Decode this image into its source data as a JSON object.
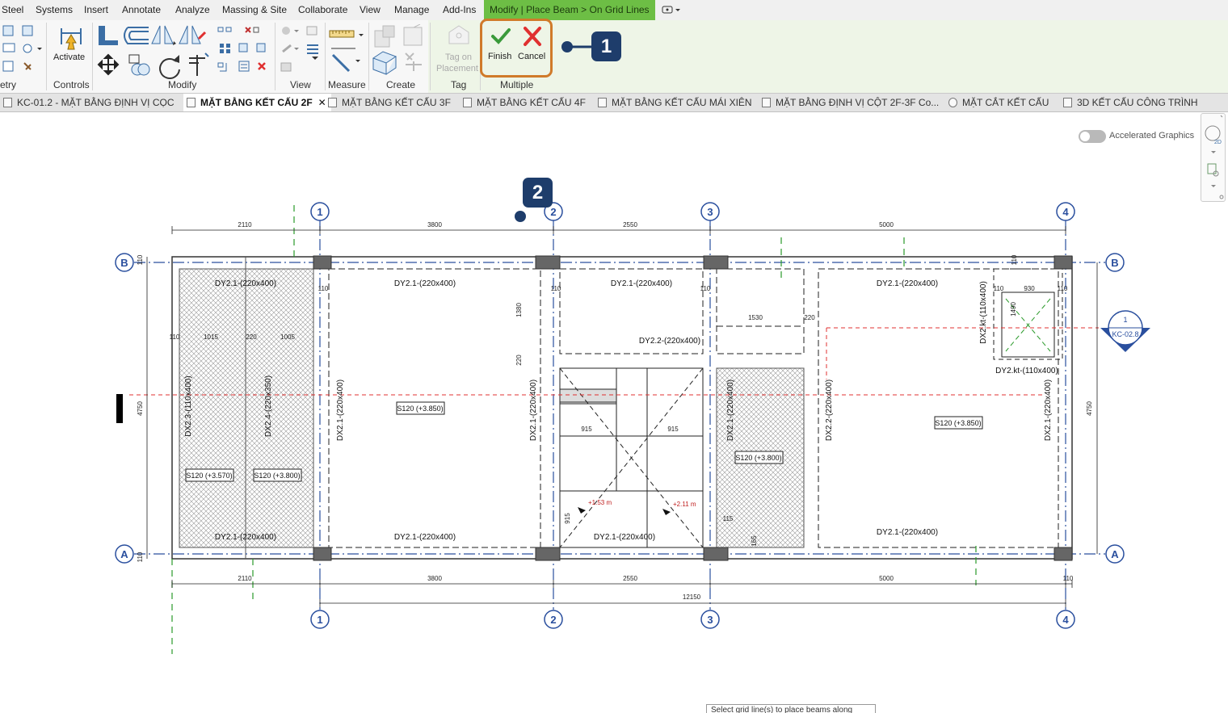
{
  "menu": {
    "items": [
      "Steel",
      "Systems",
      "Insert",
      "Annotate",
      "Analyze",
      "Massing & Site",
      "Collaborate",
      "View",
      "Manage",
      "Add-Ins"
    ],
    "context_tab": "Modify | Place Beam > On Grid Lines"
  },
  "ribbon": {
    "panels": {
      "geometry": "etry",
      "controls": "Controls",
      "modify": "Modify",
      "view": "View",
      "measure": "Measure",
      "create": "Create",
      "tag": "Tag",
      "multiple": "Multiple"
    },
    "activate_label": "Activate",
    "tag_on_label_1": "Tag on",
    "tag_on_label_2": "Placement",
    "finish_label": "Finish",
    "cancel_label": "Cancel"
  },
  "tabs": [
    {
      "label": "KC-01.2 - MẶT BẰNG ĐỊNH VỊ CỌC"
    },
    {
      "label": "MẶT BẰNG KẾT CẤU 2F"
    },
    {
      "label": "MẶT BẰNG KẾT CẤU 3F"
    },
    {
      "label": "MẶT BẰNG KẾT CẤU 4F"
    },
    {
      "label": "MẶT BẰNG KẾT CẤU MÁI XIÊN"
    },
    {
      "label": "MẶT BẰNG ĐỊNH VỊ CỘT 2F-3F Co..."
    },
    {
      "label": "MẶT CẮT KẾT CẤU"
    },
    {
      "label": "3D KẾT CẤU CÔNG TRÌNH"
    }
  ],
  "canvas": {
    "accelerated_graphics": "Accelerated Graphics",
    "status_text": "Select grid line(s) to place beams along"
  },
  "callouts": {
    "one": "1",
    "two": "2"
  },
  "drawing": {
    "grid_cols": [
      "1",
      "2",
      "3",
      "4"
    ],
    "grid_rows": [
      "B",
      "A"
    ],
    "top_dims": [
      "2110",
      "3800",
      "2550",
      "5000"
    ],
    "bottom_dims": [
      "2110",
      "3800",
      "2550",
      "5000",
      "110"
    ],
    "overall_dim": "12150",
    "side_dims": {
      "height": "4750",
      "b_edge": "110",
      "a_edge": "110"
    },
    "beams": {
      "dy21": "DY2.1-(220x400)",
      "dy22": "DY2.2-(220x400)",
      "dy2kt": "DY2.kt-(110x400)",
      "dx21": "DX2.1-(220x400)",
      "dx22": "DX2.2-(220x400)",
      "dx23": "DX2.3-(110x400)",
      "dx24": "DX2.4-(220x350)",
      "dx2kt": "DX2.kt-(110x400)"
    },
    "slabs": {
      "s3570": "S120 (+3.570)",
      "s3800": "S120 (+3.800)",
      "s3850": "S120 (+3.850)"
    },
    "small_dims": {
      "d110": "110",
      "d1015": "1015",
      "d220": "220",
      "d1005": "1005",
      "d1380": "1380",
      "d1530": "1530",
      "d915": "915",
      "d115": "115",
      "d165": "165",
      "d930": "930",
      "d1490": "1490"
    },
    "levels": {
      "l1": "+1.53 m",
      "l2": "+2.11 m"
    },
    "section": {
      "num": "1",
      "sheet": "KC-02.8"
    }
  }
}
